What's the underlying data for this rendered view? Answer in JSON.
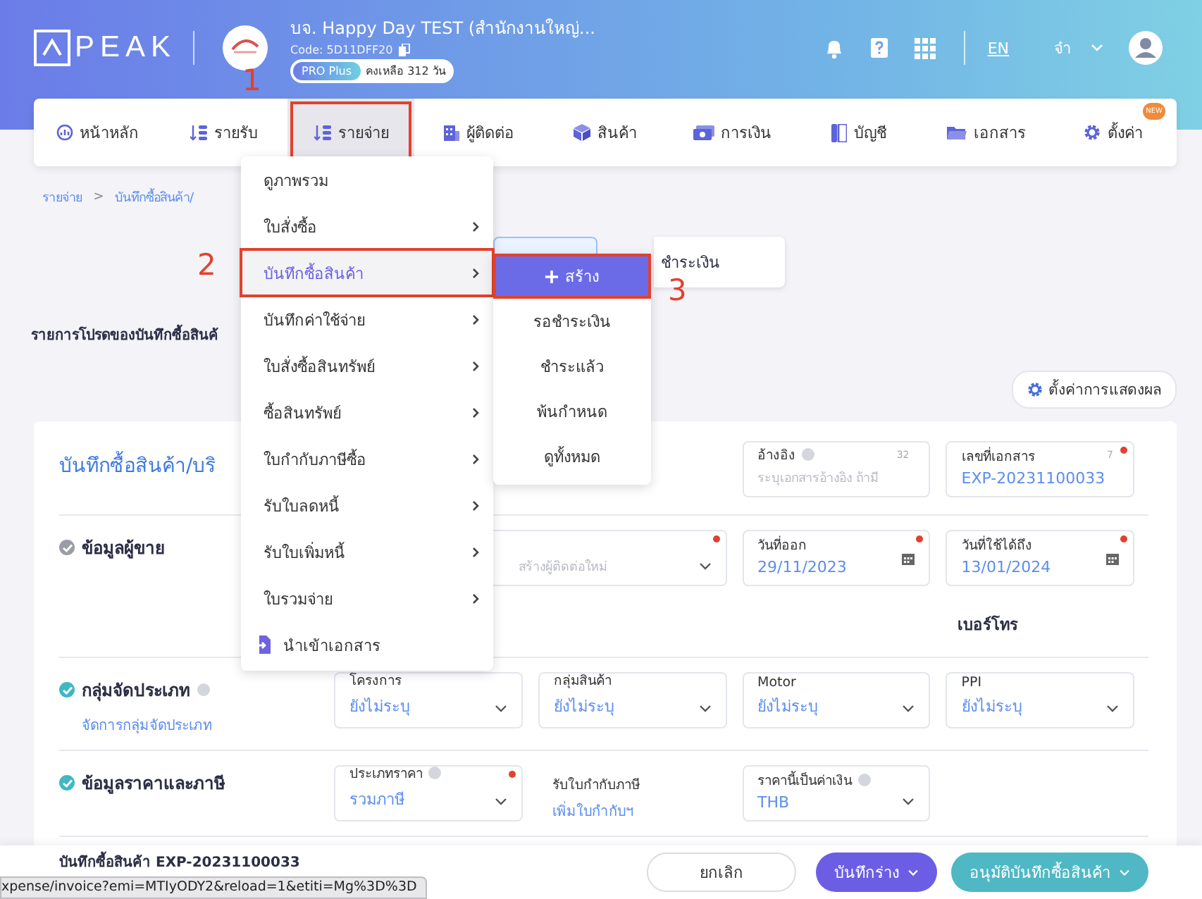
{
  "header": {
    "logo": "PEAK",
    "company": {
      "name": "บจ. Happy Day TEST (สำนักงานใหญ่...",
      "code": "Code: 5D11DFF20",
      "plan": "PRO Plus",
      "remaining": "คงเหลือ 312 วัน"
    },
    "language": "EN",
    "user": "จ๋า"
  },
  "nav": [
    {
      "label": "หน้าหลัก",
      "selected": false
    },
    {
      "label": "รายรับ",
      "selected": false
    },
    {
      "label": "รายจ่าย",
      "selected": true,
      "highlighted": true,
      "callout": "1"
    },
    {
      "label": "ผู้ติดต่อ",
      "selected": false
    },
    {
      "label": "สินค้า",
      "selected": false
    },
    {
      "label": "การเงิน",
      "selected": false
    },
    {
      "label": "บัญชี",
      "selected": false
    },
    {
      "label": "เอกสาร",
      "selected": false
    },
    {
      "label": "ตั้งค่า",
      "selected": false,
      "badge": "NEW"
    }
  ],
  "breadcrumb": {
    "items": [
      "รายจ่าย",
      "บันทึกซื้อสินค้า/"
    ],
    "separator": ">"
  },
  "status_tabs": [
    {
      "label": "ชำระเงิน",
      "selected": false
    }
  ],
  "favorites": {
    "title": "รายการโปรดของบันทึกซื้อสินค้",
    "settings_button": "ตั้งค่าการแสดงผล"
  },
  "form": {
    "title": "บันทึกซื้อสินค้า/บริ",
    "reference": {
      "label": "อ้างอิง",
      "help": true,
      "counter": "32",
      "placeholder": "ระบุเอกสารอ้างอิง ถ้ามี"
    },
    "doc_number": {
      "label": "เลขที่เอกสาร",
      "counter": "7",
      "required": true,
      "value": "EXP-20231100033"
    },
    "sections": [
      {
        "kind": "vendor",
        "title": "ข้อมูลผู้ขาย",
        "color": "#9a9ca6",
        "contact_placeholder": "สร้างผู้ติดต่อใหม่",
        "contact_required": true,
        "dates": [
          {
            "label": "วันที่ออก",
            "value": "29/11/2023",
            "required": true
          },
          {
            "label": "วันที่ใช้ได้ถึง",
            "value": "13/01/2024",
            "required": true
          }
        ],
        "phone_label": "เบอร์โทร"
      },
      {
        "kind": "fields",
        "title": "กลุ่มจัดประเภท",
        "help": true,
        "link": "จัดการกลุ่มจัดประเภท",
        "color": "#3fb8c4",
        "fields": [
          {
            "kind": "select",
            "label": "โครงการ",
            "value": "ยังไม่ระบุ"
          },
          {
            "kind": "select",
            "label": "กลุ่มสินค้า",
            "value": "ยังไม่ระบุ"
          },
          {
            "kind": "select",
            "label": "Motor",
            "value": "ยังไม่ระบุ"
          },
          {
            "kind": "select",
            "label": "PPI",
            "value": "ยังไม่ระบุ"
          }
        ]
      },
      {
        "kind": "fields",
        "title": "ข้อมูลราคาและภาษี",
        "color": "#3fb8c4",
        "fields": [
          {
            "kind": "select",
            "label": "ประเภทราคา",
            "help": true,
            "required": true,
            "value": "รวมภาษี"
          },
          {
            "kind": "link",
            "label": "รับใบกำกับภาษี",
            "value": "เพิ่มใบกำกับฯ"
          },
          {
            "kind": "select",
            "label": "ราคานี้เป็นค่าเงิน",
            "help": true,
            "value": "THB"
          }
        ]
      }
    ]
  },
  "footer": {
    "title": "บันทึกซื้อสินค้า EXP-20231100033",
    "buttons": [
      {
        "label": "ยกเลิก",
        "kind": "outline"
      },
      {
        "label": "บันทึกร่าง",
        "kind": "primary",
        "dropdown": true
      },
      {
        "label": "อนุมัติบันทึกซื้อสินค้า",
        "kind": "success",
        "dropdown": true
      }
    ]
  },
  "menu": {
    "items": [
      {
        "kind": "item",
        "label": "ดูภาพรวม",
        "submenu": false,
        "selected": false
      },
      {
        "kind": "item",
        "label": "ใบสั่งซื้อ",
        "submenu": true,
        "selected": false
      },
      {
        "kind": "item",
        "label": "บันทึกซื้อสินค้า",
        "submenu": true,
        "selected": true,
        "highlighted": true,
        "callout": "2"
      },
      {
        "kind": "item",
        "label": "บันทึกค่าใช้จ่าย",
        "submenu": true,
        "selected": false
      },
      {
        "kind": "item",
        "label": "ใบสั่งซื้อสินทรัพย์",
        "submenu": true,
        "selected": false
      },
      {
        "kind": "item",
        "label": "ซื้อสินทรัพย์",
        "submenu": true,
        "selected": false
      },
      {
        "kind": "item",
        "label": "ใบกำกับภาษีซื้อ",
        "submenu": true,
        "selected": false
      },
      {
        "kind": "item",
        "label": "รับใบลดหนี้",
        "submenu": true,
        "selected": false
      },
      {
        "kind": "item",
        "label": "รับใบเพิ่มหนี้",
        "submenu": true,
        "selected": false
      },
      {
        "kind": "item",
        "label": "ใบรวมจ่าย",
        "submenu": true,
        "selected": false
      },
      {
        "kind": "import",
        "label": "นำเข้าเอกสาร"
      }
    ]
  },
  "submenu": {
    "items": [
      {
        "kind": "create",
        "label": "สร้าง",
        "highlighted": true,
        "callout": "3"
      },
      {
        "kind": "link",
        "label": "รอชำระเงิน"
      },
      {
        "kind": "link",
        "label": "ชำระแล้ว"
      },
      {
        "kind": "link",
        "label": "พ้นกำหนด"
      },
      {
        "kind": "link",
        "label": "ดูทั้งหมด"
      }
    ]
  },
  "status_url": "xpense/invoice?emi=MTIyODY2&reload=1&etiti=Mg%3D%3D"
}
